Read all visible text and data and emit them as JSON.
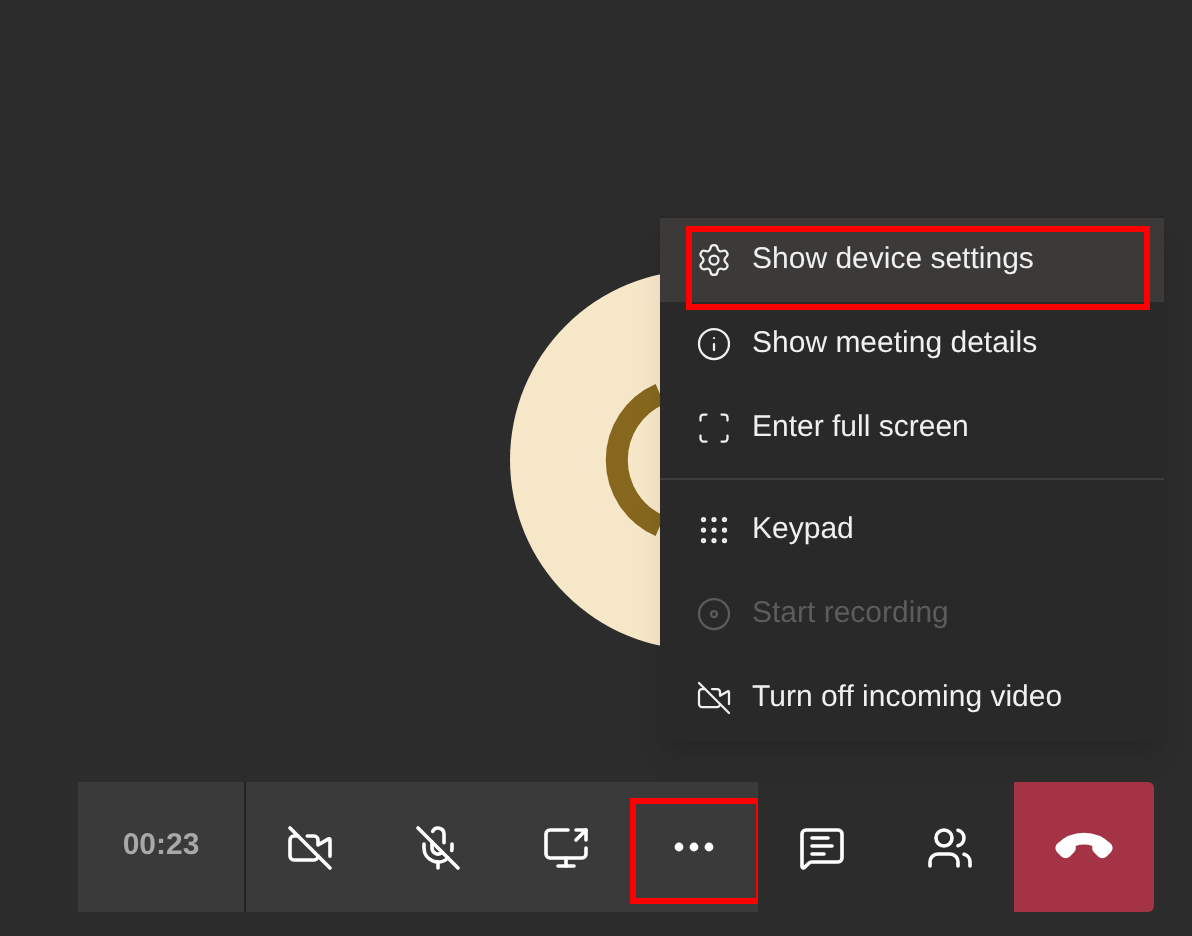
{
  "menu": {
    "items": [
      {
        "label": "Show device settings",
        "selected": true,
        "disabled": false,
        "annotated": true
      },
      {
        "label": "Show meeting details",
        "selected": false,
        "disabled": false,
        "annotated": false
      },
      {
        "label": "Enter full screen",
        "selected": false,
        "disabled": false,
        "annotated": false
      },
      {
        "label": "Keypad",
        "selected": false,
        "disabled": false,
        "annotated": false,
        "divider_before": true
      },
      {
        "label": "Start recording",
        "selected": false,
        "disabled": true,
        "annotated": false
      },
      {
        "label": "Turn off incoming video",
        "selected": false,
        "disabled": false,
        "annotated": false
      }
    ]
  },
  "toolbar": {
    "timer": "00:23",
    "buttons": [
      {
        "kind": "camera-off",
        "annotated": false
      },
      {
        "kind": "mic-off",
        "annotated": false
      },
      {
        "kind": "share",
        "annotated": false
      },
      {
        "kind": "more",
        "annotated": true
      },
      {
        "kind": "chat",
        "annotated": false
      },
      {
        "kind": "people",
        "annotated": false
      },
      {
        "kind": "hang-up",
        "annotated": false
      }
    ]
  }
}
